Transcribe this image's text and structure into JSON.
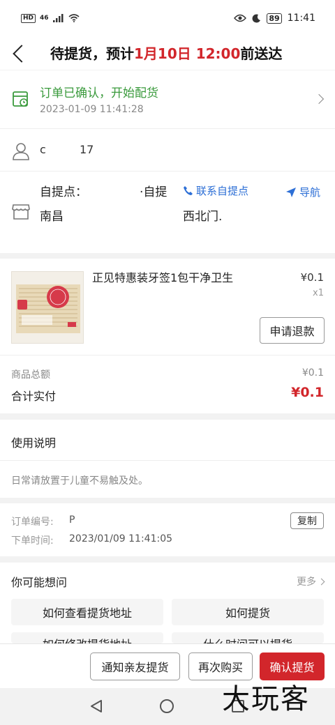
{
  "status_bar": {
    "hd": "HD",
    "signal": "46",
    "battery": "89",
    "time": "11:41"
  },
  "header": {
    "title_prefix": "待提货，预计",
    "title_date": "1月10日 12:00",
    "title_suffix": "前送达"
  },
  "delivery": {
    "status_title": "订单已确认，开始配货",
    "status_time": "2023-01-09 11:41:28",
    "contact_name": "c",
    "contact_phone": "17",
    "pickup_label": "自提点：",
    "pickup_name": "·自提",
    "contact_link": "联系自提点",
    "address_prefix": "南昌",
    "address_suffix": "西北门.",
    "nav_label": "导航"
  },
  "product": {
    "name": "正见特惠装牙签1包干净卫生",
    "price": "¥0.1",
    "qty": "x1",
    "refund_label": "申请退款",
    "image_brand": "正见",
    "image_text": "正见美居"
  },
  "summary": {
    "goods_total_label": "商品总额",
    "goods_total_value": "¥0.1",
    "paid_label": "合计实付",
    "paid_value": "¥0.1"
  },
  "usage": {
    "title": "使用说明",
    "text": "日常请放置于儿童不易触及处。"
  },
  "order": {
    "number_label": "订单编号:",
    "number_value": "P",
    "copy_label": "复制",
    "time_label": "下单时间:",
    "time_value": "2023/01/09 11:41:05"
  },
  "faq": {
    "title": "你可能想问",
    "more": "更多",
    "items": [
      "如何查看提货地址",
      "如何提货",
      "如何修改提货地址",
      "什么时间可以提货"
    ]
  },
  "bottom_bar": {
    "notify_label": "通知亲友提货",
    "rebuy_label": "再次购买",
    "confirm_label": "确认提货"
  },
  "watermark": "大玩客",
  "colors": {
    "accent_red": "#d2262b",
    "status_green": "#3a9a3c",
    "link_blue": "#2d6fd6"
  }
}
